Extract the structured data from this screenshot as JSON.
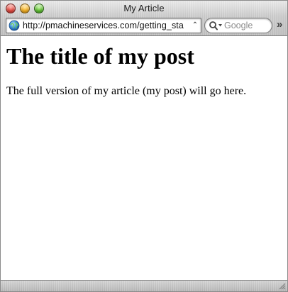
{
  "window": {
    "title": "My Article"
  },
  "toolbar": {
    "address_value": "http://pmachineservices.com/getting_sta",
    "search_placeholder": "Google",
    "overflow_glyph": "»",
    "snapback_glyph": "⌃"
  },
  "page": {
    "title": "The title of my post",
    "body": "The full version of my article (my post) will go here."
  },
  "colors": {
    "close": "#e0433a",
    "minimize": "#f2ad1d",
    "zoom": "#5bbf2d"
  },
  "icons": [
    "globe-icon",
    "magnifier-icon",
    "overflow-chevron-icon",
    "resize-grip-icon"
  ]
}
